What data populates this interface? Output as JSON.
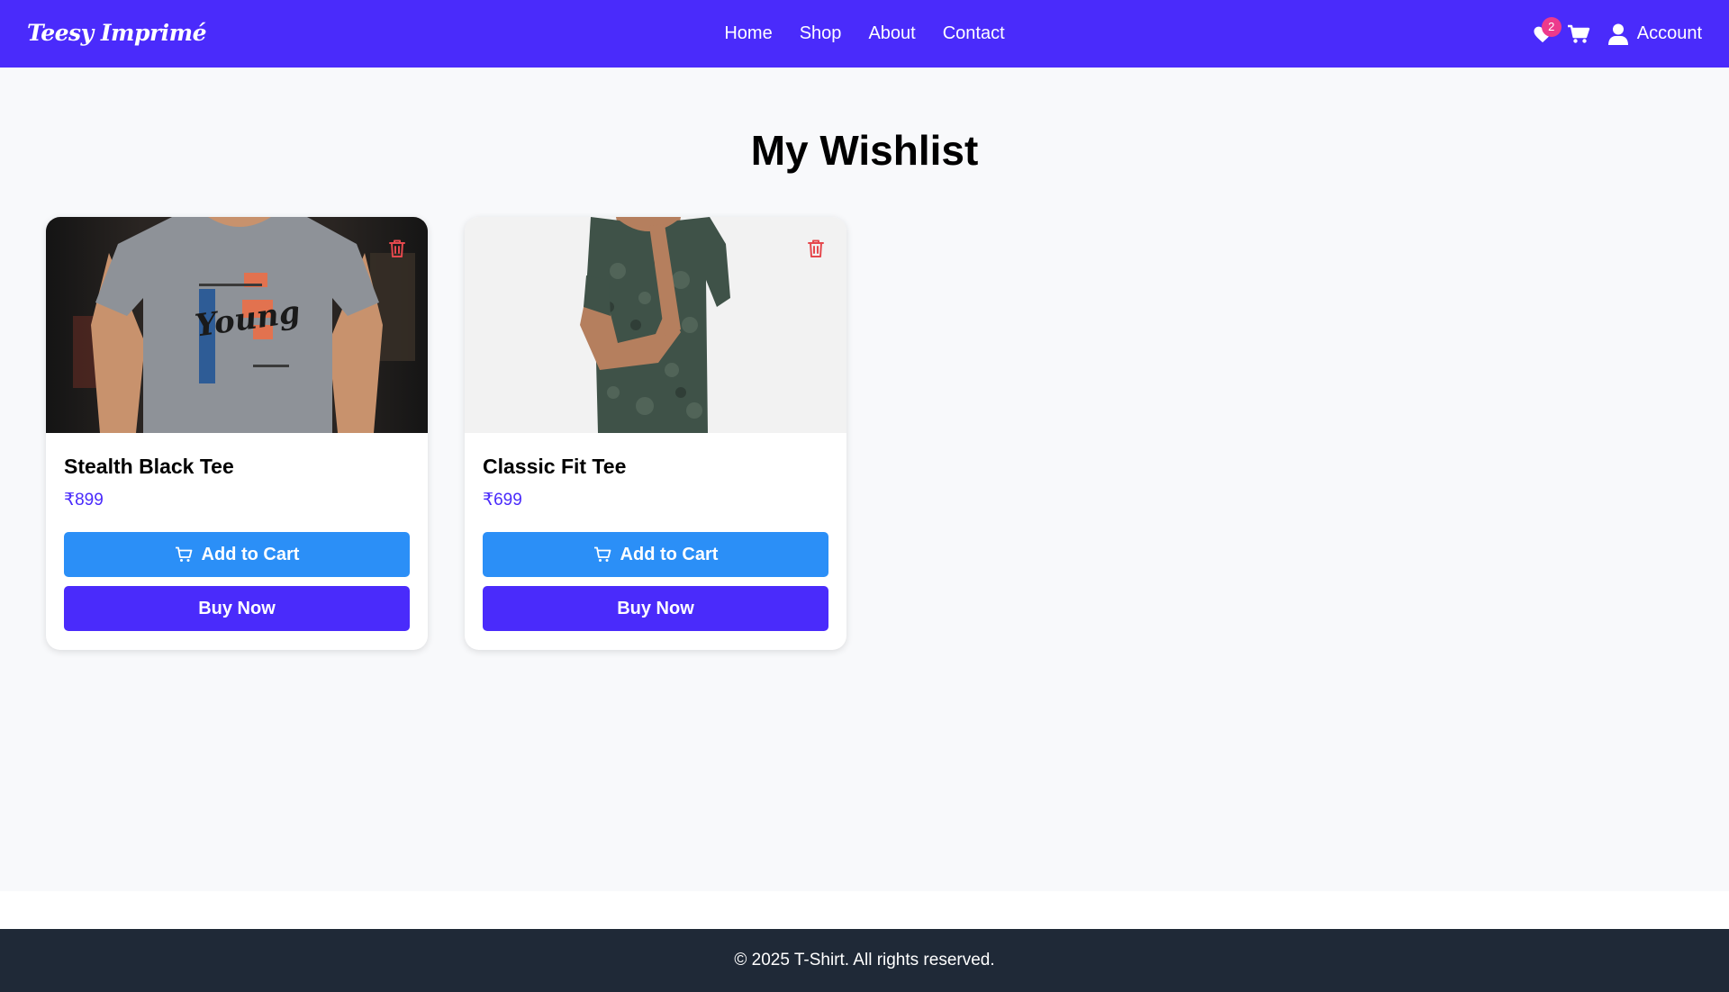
{
  "header": {
    "brand": "Teesy Imprimé",
    "nav": [
      "Home",
      "Shop",
      "About",
      "Contact"
    ],
    "wishlist_count": "2",
    "account_label": "Account"
  },
  "page": {
    "title": "My Wishlist"
  },
  "products": [
    {
      "name": "Stealth Black Tee",
      "price": "₹899",
      "add_label": "Add to Cart",
      "buy_label": "Buy Now"
    },
    {
      "name": "Classic Fit Tee",
      "price": "₹699",
      "add_label": "Add to Cart",
      "buy_label": "Buy Now"
    }
  ],
  "footer": {
    "text": "© 2025 T-Shirt. All rights reserved."
  },
  "colors": {
    "primary": "#4a2bfb",
    "cart_button": "#2b8ff7",
    "badge": "#ec3a8c",
    "trash": "#e5484d",
    "footer_bg": "#1f2937",
    "page_bg": "#f8f9fb"
  }
}
